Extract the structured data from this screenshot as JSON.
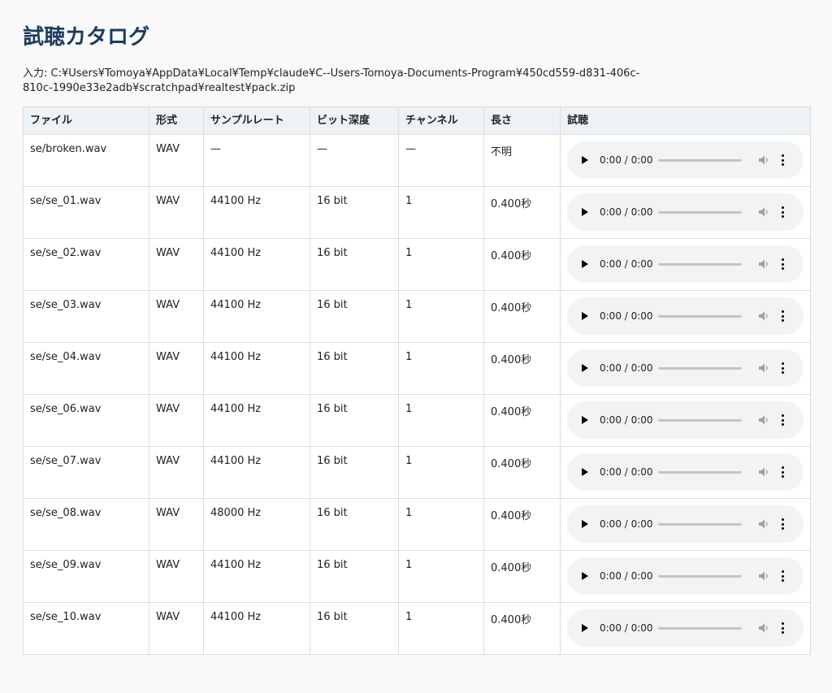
{
  "page": {
    "title": "試聴カタログ",
    "input_path": "入力: C:¥Users¥Tomoya¥AppData¥Local¥Temp¥claude¥C--Users-Tomoya-Documents-Program¥450cd559-d831-406c-810c-1990e33e2adb¥scratchpad¥realtest¥pack.zip"
  },
  "table": {
    "headers": [
      "ファイル",
      "形式",
      "サンプルレート",
      "ビット深度",
      "チャンネル",
      "長さ",
      "試聴"
    ],
    "rows": [
      {
        "file": "se/broken.wav",
        "format": "WAV",
        "rate": "—",
        "bits": "—",
        "channels": "—",
        "length": "不明",
        "time": "0:00 / 0:00"
      },
      {
        "file": "se/se_01.wav",
        "format": "WAV",
        "rate": "44100 Hz",
        "bits": "16 bit",
        "channels": "1",
        "length": "0.400秒",
        "time": "0:00 / 0:00"
      },
      {
        "file": "se/se_02.wav",
        "format": "WAV",
        "rate": "44100 Hz",
        "bits": "16 bit",
        "channels": "1",
        "length": "0.400秒",
        "time": "0:00 / 0:00"
      },
      {
        "file": "se/se_03.wav",
        "format": "WAV",
        "rate": "44100 Hz",
        "bits": "16 bit",
        "channels": "1",
        "length": "0.400秒",
        "time": "0:00 / 0:00"
      },
      {
        "file": "se/se_04.wav",
        "format": "WAV",
        "rate": "44100 Hz",
        "bits": "16 bit",
        "channels": "1",
        "length": "0.400秒",
        "time": "0:00 / 0:00"
      },
      {
        "file": "se/se_06.wav",
        "format": "WAV",
        "rate": "44100 Hz",
        "bits": "16 bit",
        "channels": "1",
        "length": "0.400秒",
        "time": "0:00 / 0:00"
      },
      {
        "file": "se/se_07.wav",
        "format": "WAV",
        "rate": "44100 Hz",
        "bits": "16 bit",
        "channels": "1",
        "length": "0.400秒",
        "time": "0:00 / 0:00"
      },
      {
        "file": "se/se_08.wav",
        "format": "WAV",
        "rate": "48000 Hz",
        "bits": "16 bit",
        "channels": "1",
        "length": "0.400秒",
        "time": "0:00 / 0:00"
      },
      {
        "file": "se/se_09.wav",
        "format": "WAV",
        "rate": "44100 Hz",
        "bits": "16 bit",
        "channels": "1",
        "length": "0.400秒",
        "time": "0:00 / 0:00"
      },
      {
        "file": "se/se_10.wav",
        "format": "WAV",
        "rate": "44100 Hz",
        "bits": "16 bit",
        "channels": "1",
        "length": "0.400秒",
        "time": "0:00 / 0:00"
      }
    ]
  },
  "icons": {
    "play": "play-icon",
    "volume": "volume-icon",
    "menu": "more-vertical-icon"
  }
}
